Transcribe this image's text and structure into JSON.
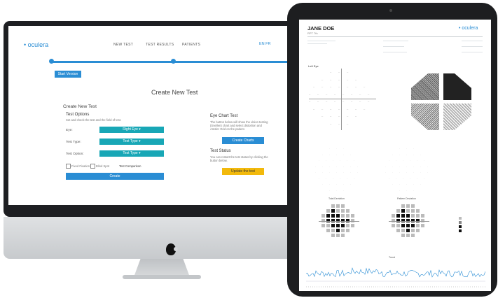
{
  "colors": {
    "accent": "#2a8dd4",
    "teal": "#18a7b6",
    "yellow": "#f2b90c"
  },
  "imac": {
    "brand": "• oculera",
    "nav": [
      "NEW TEST",
      "TEST RESULTS",
      "PATIENTS"
    ],
    "lang": "EN FR",
    "start_button": "Start Version",
    "page_title": "Create New Test",
    "form_heading": "Create New Test",
    "test_options_title": "Test Options",
    "test_options_hint": "Set and check the test and the field of test.",
    "eye_label": "Eye:",
    "eye_value": "Right Eye ▾",
    "test_type_label": "Test Type:",
    "test_type_value": "Test Type ▾",
    "test_option_label": "Test Option:",
    "test_option_value": "Test Type ▾",
    "option_a": "Fixed Fixation",
    "option_b": "Blind Spot",
    "option_c": "Test Comparison",
    "create_button": "Create",
    "eye_chart_title": "Eye Chart Test",
    "eye_chart_text": "The button below will show the vision testing (Snellen) chart and select distortion and Amsler Grid on the patient.",
    "eye_chart_button": "Create Charts",
    "status_title": "Test Status",
    "status_text": "You can restart the test status by clicking the button below.",
    "status_button": "Update the test"
  },
  "report": {
    "name": "JANE DOE",
    "id": "RPT 7th",
    "brand": "• oculera",
    "eye": "Left Eye",
    "total_deviation": "Total Deviation",
    "pattern_deviation": "Pattern Deviation",
    "trend_label": "Trend"
  }
}
